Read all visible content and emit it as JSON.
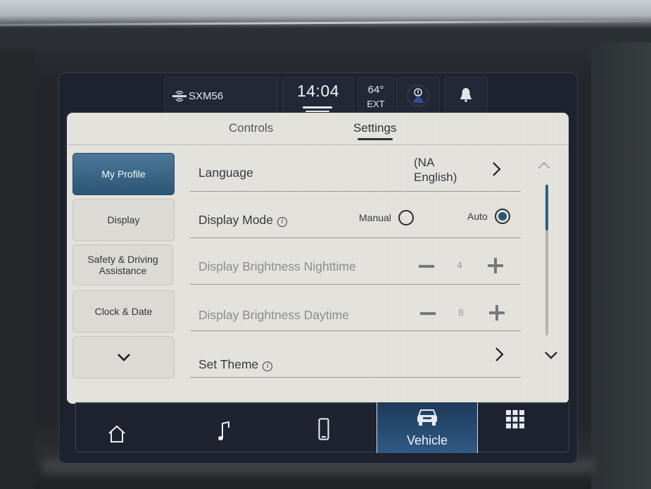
{
  "status_bar": {
    "radio_icon": "siriusxm-icon",
    "radio_station": "SXM56",
    "time": "14:04",
    "temperature": "64°",
    "temperature_label": "EXT",
    "alert_icon": "driver-alert-icon",
    "notification_icon": "bell-icon"
  },
  "tabs": [
    {
      "label": "Controls",
      "active": false
    },
    {
      "label": "Settings",
      "active": true
    }
  ],
  "sidebar": {
    "items": [
      {
        "label": "My Profile",
        "active": true
      },
      {
        "label": "Display",
        "active": false
      },
      {
        "label": "Safety & Driving Assistance",
        "active": false
      },
      {
        "label": "Clock & Date",
        "active": false
      }
    ],
    "more_icon": "chevron-down-icon"
  },
  "settings": {
    "language": {
      "label": "Language",
      "value": "(NA English)",
      "value_line1": "(NA",
      "value_line2": "English)"
    },
    "display_mode": {
      "label": "Display Mode",
      "options": [
        {
          "label": "Manual",
          "selected": false
        },
        {
          "label": "Auto",
          "selected": true
        }
      ]
    },
    "brightness_night": {
      "label": "Display Brightness Nighttime",
      "value": "4",
      "enabled": false
    },
    "brightness_day": {
      "label": "Display Brightness Daytime",
      "value": "8",
      "enabled": false
    },
    "set_theme": {
      "label": "Set Theme"
    }
  },
  "scrollbar": {
    "position_fraction": 0.0,
    "visible_fraction": 0.3
  },
  "bottom_nav": {
    "items": [
      {
        "icon": "home-icon",
        "label": ""
      },
      {
        "icon": "music-note-icon",
        "label": ""
      },
      {
        "icon": "phone-icon",
        "label": ""
      },
      {
        "icon": "vehicle-icon",
        "label": "Vehicle",
        "active": true
      },
      {
        "icon": "apps-grid-icon",
        "label": ""
      }
    ]
  },
  "colors": {
    "accent": "#2d5675",
    "panel_bg": "#e4e3de",
    "status_bar_bg": "#1e2330"
  }
}
